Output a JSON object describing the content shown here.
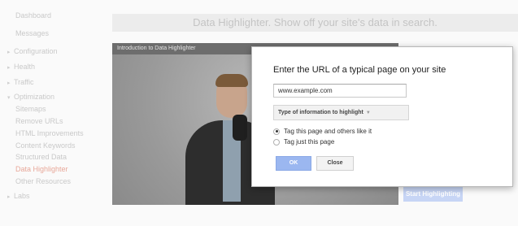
{
  "sidebar": {
    "items": [
      {
        "label": "Dashboard"
      },
      {
        "label": "Messages"
      },
      {
        "label": "Configuration"
      },
      {
        "label": "Health"
      },
      {
        "label": "Traffic"
      },
      {
        "label": "Optimization"
      },
      {
        "label": "Sitemaps"
      },
      {
        "label": "Remove URLs"
      },
      {
        "label": "HTML Improvements"
      },
      {
        "label": "Content Keywords"
      },
      {
        "label": "Structured Data"
      },
      {
        "label": "Data Highlighter"
      },
      {
        "label": "Other Resources"
      },
      {
        "label": "Labs"
      }
    ]
  },
  "main": {
    "banner_title": "Data Highlighter. Show off your site's data in search.",
    "video_title": "Introduction to Data Highlighter",
    "start_button": "Start Highlighting"
  },
  "dialog": {
    "title": "Enter the URL of a typical page on your site",
    "url_value": "www.example.com",
    "type_dropdown": "Type of information to highlight",
    "radio_1": "Tag this page and others like it",
    "radio_2": "Tag just this page",
    "ok_label": "OK",
    "close_label": "Close"
  },
  "colors": {
    "accent_active": "#e8a89a",
    "ok_button": "#9bb7f0",
    "start_button": "#c7d5f5"
  }
}
